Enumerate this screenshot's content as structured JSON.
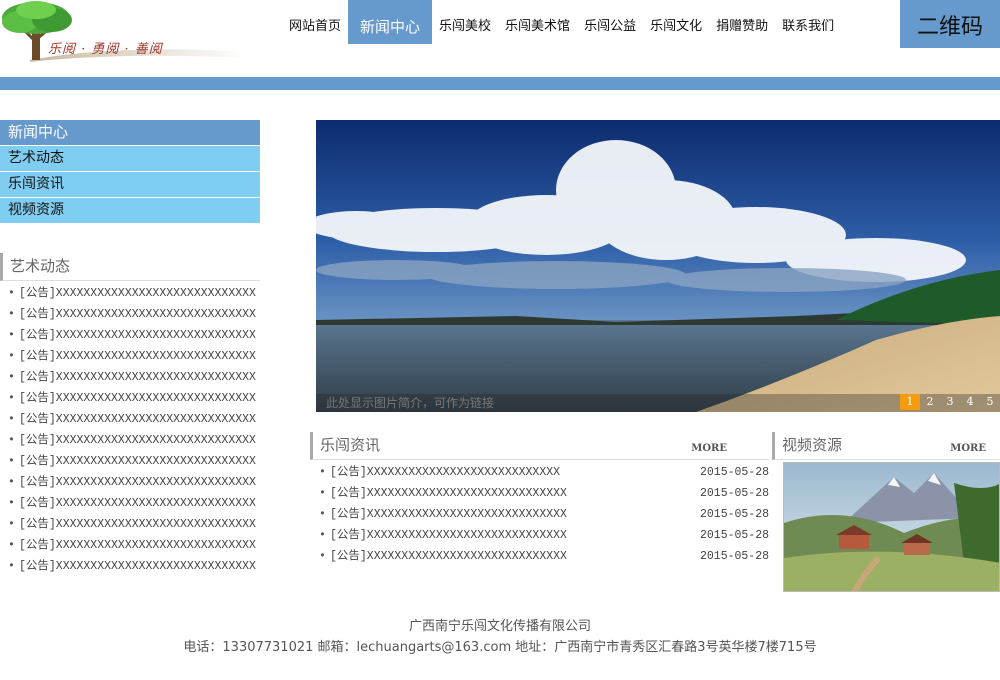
{
  "header": {
    "logo_text": "乐阅 · 勇阅 · 善阅",
    "nav": [
      {
        "label": "网站首页",
        "active": false
      },
      {
        "label": "新闻中心",
        "active": true
      },
      {
        "label": "乐闯美校",
        "active": false
      },
      {
        "label": "乐闯美术馆",
        "active": false
      },
      {
        "label": "乐闯公益",
        "active": false
      },
      {
        "label": "乐闯文化",
        "active": false
      },
      {
        "label": "捐赠赞助",
        "active": false
      },
      {
        "label": "联系我们",
        "active": false
      }
    ],
    "qr_label": "二维码"
  },
  "sidebar": {
    "menu": [
      "新闻中心",
      "艺术动态",
      "乐闯资讯",
      "视频资源"
    ],
    "art_section_title": "艺术动态",
    "art_items": [
      "[公告]XXXXXXXXXXXXXXXXXXXXXXXXXXXXX",
      "[公告]XXXXXXXXXXXXXXXXXXXXXXXXXXXXX",
      "[公告]XXXXXXXXXXXXXXXXXXXXXXXXXXXXX",
      "[公告]XXXXXXXXXXXXXXXXXXXXXXXXXXXXX",
      "[公告]XXXXXXXXXXXXXXXXXXXXXXXXXXXXX",
      "[公告]XXXXXXXXXXXXXXXXXXXXXXXXXXXXX",
      "[公告]XXXXXXXXXXXXXXXXXXXXXXXXXXXXX",
      "[公告]XXXXXXXXXXXXXXXXXXXXXXXXXXXXX",
      "[公告]XXXXXXXXXXXXXXXXXXXXXXXXXXXXX",
      "[公告]XXXXXXXXXXXXXXXXXXXXXXXXXXXXX",
      "[公告]XXXXXXXXXXXXXXXXXXXXXXXXXXXXX",
      "[公告]XXXXXXXXXXXXXXXXXXXXXXXXXXXXX",
      "[公告]XXXXXXXXXXXXXXXXXXXXXXXXXXXXX",
      "[公告]XXXXXXXXXXXXXXXXXXXXXXXXXXXXX"
    ]
  },
  "banner": {
    "caption": "此处显示图片简介，可作为链接",
    "pages": [
      "1",
      "2",
      "3",
      "4",
      "5"
    ],
    "active_page": "1"
  },
  "news": {
    "title": "乐闯资讯",
    "more": "MORE",
    "items": [
      {
        "text": "[公告]XXXXXXXXXXXXXXXXXXXXXXXXXXXX",
        "date": "2015-05-28"
      },
      {
        "text": "[公告]XXXXXXXXXXXXXXXXXXXXXXXXXXXXX",
        "date": "2015-05-28"
      },
      {
        "text": "[公告]XXXXXXXXXXXXXXXXXXXXXXXXXXXXX",
        "date": "2015-05-28"
      },
      {
        "text": "[公告]XXXXXXXXXXXXXXXXXXXXXXXXXXXXX",
        "date": "2015-05-28"
      },
      {
        "text": "[公告]XXXXXXXXXXXXXXXXXXXXXXXXXXXXX",
        "date": "2015-05-28"
      }
    ]
  },
  "video": {
    "title": "视频资源",
    "more": "MORE"
  },
  "footer": {
    "company": "广西南宁乐闯文化传播有限公司",
    "contact": "电话：13307731021 邮箱：lechuangarts@163.com 地址：广西南宁市青秀区汇春路3号英华楼7楼715号"
  },
  "colors": {
    "accent": "#6699cc",
    "menu_bg": "#7fcdf1",
    "pager_active": "#f39c12"
  }
}
